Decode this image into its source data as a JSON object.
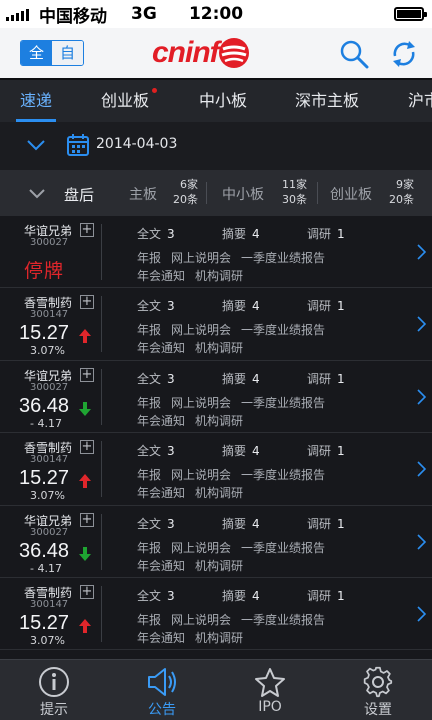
{
  "status_bar": {
    "carrier": "中国移动",
    "network": "3G",
    "time": "12:00"
  },
  "header": {
    "lang_on": "全",
    "lang_off": "自",
    "logo_text": "cninf",
    "brand_color": "#e21d26",
    "accent_color": "#1d7fe0"
  },
  "tabs": [
    {
      "label": "速递",
      "active": true,
      "dot": false
    },
    {
      "label": "创业板",
      "active": false,
      "dot": true
    },
    {
      "label": "中小板",
      "active": false,
      "dot": false
    },
    {
      "label": "深市主板",
      "active": false,
      "dot": false
    },
    {
      "label": "沪市",
      "active": false,
      "dot": false
    }
  ],
  "date_bar": {
    "date": "2014-04-03"
  },
  "summary": {
    "session": "盘后",
    "main": {
      "label": "主板",
      "home": "6家",
      "items": "20条"
    },
    "sme": {
      "label": "中小板",
      "home": "11家",
      "items": "30条"
    },
    "gem": {
      "label": "创业板",
      "home": "9家",
      "items": "20条"
    }
  },
  "labels": {
    "full": "全文",
    "abstract": "摘要",
    "research": "调研"
  },
  "rows": [
    {
      "name": "华谊兄弟",
      "code": "300027",
      "halted": "停牌",
      "full": "3",
      "abstract": "4",
      "research": "1",
      "tags1": [
        "年报",
        "网上说明会",
        "一季度业绩报告"
      ],
      "tags2": [
        "年会通知",
        "机构调研"
      ]
    },
    {
      "name": "香雪制药",
      "code": "300147",
      "price": "15.27",
      "change": "3.07%",
      "direction": "up",
      "full": "3",
      "abstract": "4",
      "research": "1",
      "tags1": [
        "年报",
        "网上说明会",
        "一季度业绩报告"
      ],
      "tags2": [
        "年会通知",
        "机构调研"
      ]
    },
    {
      "name": "华谊兄弟",
      "code": "300027",
      "price": "36.48",
      "change": "- 4.17",
      "direction": "down",
      "full": "3",
      "abstract": "4",
      "research": "1",
      "tags1": [
        "年报",
        "网上说明会",
        "一季度业绩报告"
      ],
      "tags2": [
        "年会通知",
        "机构调研"
      ]
    },
    {
      "name": "香雪制药",
      "code": "300147",
      "price": "15.27",
      "change": "3.07%",
      "direction": "up",
      "full": "3",
      "abstract": "4",
      "research": "1",
      "tags1": [
        "年报",
        "网上说明会",
        "一季度业绩报告"
      ],
      "tags2": [
        "年会通知",
        "机构调研"
      ]
    },
    {
      "name": "华谊兄弟",
      "code": "300027",
      "price": "36.48",
      "change": "- 4.17",
      "direction": "down",
      "full": "3",
      "abstract": "4",
      "research": "1",
      "tags1": [
        "年报",
        "网上说明会",
        "一季度业绩报告"
      ],
      "tags2": [
        "年会通知",
        "机构调研"
      ]
    },
    {
      "name": "香雪制药",
      "code": "300147",
      "price": "15.27",
      "change": "3.07%",
      "direction": "up",
      "full": "3",
      "abstract": "4",
      "research": "1",
      "tags1": [
        "年报",
        "网上说明会",
        "一季度业绩报告"
      ],
      "tags2": [
        "年会通知",
        "机构调研"
      ]
    }
  ],
  "colors": {
    "up": "#e0262b",
    "down": "#1fa532",
    "halted": "#e0262b",
    "active_blue": "#3a9bf5"
  },
  "bottom_nav": [
    {
      "label": "提示",
      "icon": "info-icon",
      "active": false
    },
    {
      "label": "公告",
      "icon": "speaker-icon",
      "active": true
    },
    {
      "label": "IPO",
      "icon": "star-icon",
      "active": false
    },
    {
      "label": "设置",
      "icon": "gear-icon",
      "active": false
    }
  ]
}
